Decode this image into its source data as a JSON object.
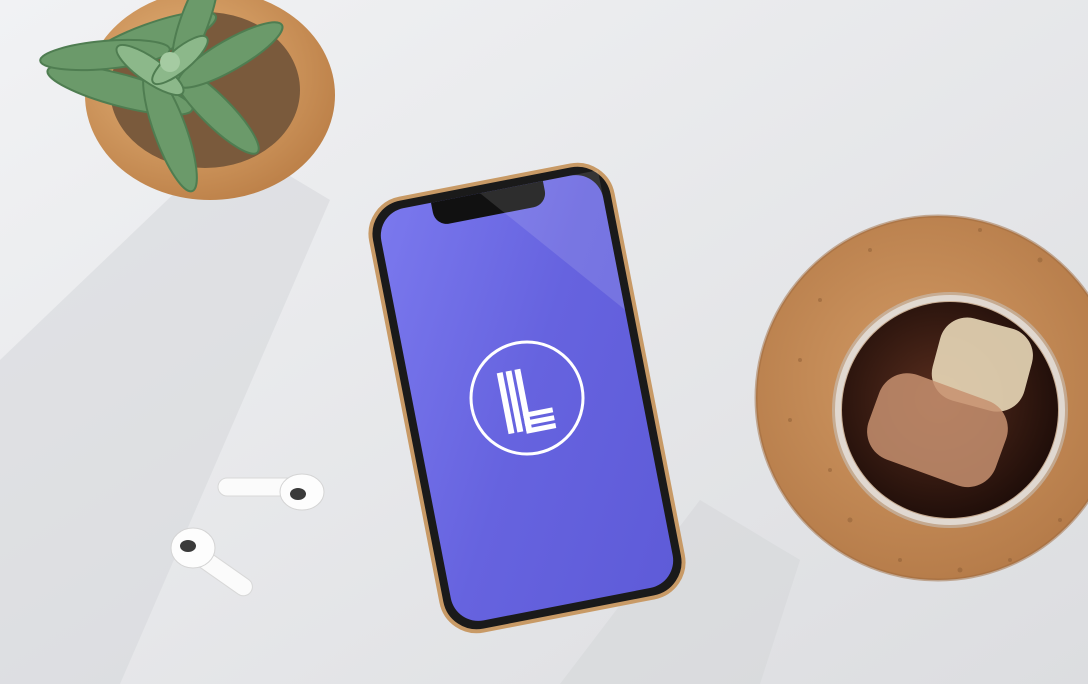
{
  "scene": {
    "description_items": [
      "succulent-plant",
      "smartphone",
      "wireless-earbuds",
      "iced-coffee-glass",
      "cork-coaster"
    ]
  },
  "phone": {
    "screen_color": "#6764e0",
    "logo_icon": "letter-l-logo"
  },
  "colors": {
    "desk": "#e9eaec",
    "cork": "#c98f5b",
    "pot": "#d49a5e",
    "plant": "#6b9a6a",
    "coffee": "#2a1610"
  }
}
